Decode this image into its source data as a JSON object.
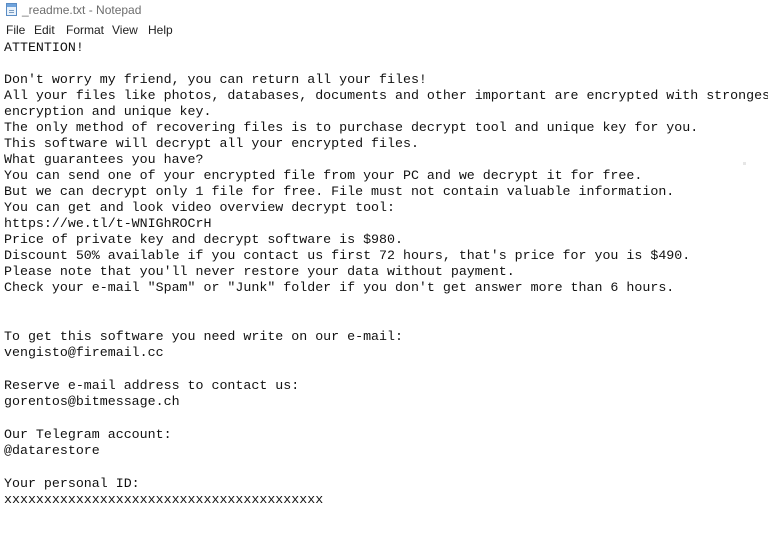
{
  "window": {
    "title": "_readme.txt - Notepad",
    "icon": "notepad-icon"
  },
  "menu": {
    "file": "File",
    "edit": "Edit",
    "format": "Format",
    "view": "View",
    "help": "Help"
  },
  "document": {
    "lines": [
      "ATTENTION!",
      "",
      "Don't worry my friend, you can return all your files!",
      "All your files like photos, databases, documents and other important are encrypted with strongest",
      "encryption and unique key.",
      "The only method of recovering files is to purchase decrypt tool and unique key for you.",
      "This software will decrypt all your encrypted files.",
      "What guarantees you have?",
      "You can send one of your encrypted file from your PC and we decrypt it for free.",
      "But we can decrypt only 1 file for free. File must not contain valuable information.",
      "You can get and look video overview decrypt tool:",
      "https://we.tl/t-WNIGhROCrH",
      "Price of private key and decrypt software is $980.",
      "Discount 50% available if you contact us first 72 hours, that's price for you is $490.",
      "Please note that you'll never restore your data without payment.",
      "Check your e-mail \"Spam\" or \"Junk\" folder if you don't get answer more than 6 hours.",
      "",
      "",
      "To get this software you need write on our e-mail:",
      "vengisto@firemail.cc",
      "",
      "Reserve e-mail address to contact us:",
      "gorentos@bitmessage.ch",
      "",
      "Our Telegram account:",
      "@datarestore",
      "",
      "Your personal ID:",
      "xxxxxxxxxxxxxxxxxxxxxxxxxxxxxxxxxxxxxxxx"
    ]
  }
}
